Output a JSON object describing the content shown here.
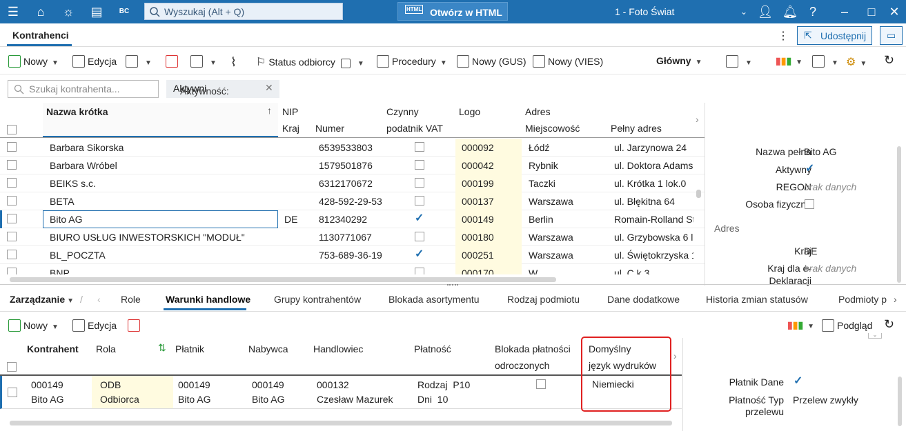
{
  "titlebar": {
    "search_placeholder": "Wyszukaj (Alt + Q)",
    "html_button": "Otwórz w HTML",
    "company": "1 - Foto Świat"
  },
  "tabbar": {
    "active_tab": "Kontrahenci",
    "share": "Udostępnij"
  },
  "toolbar": {
    "new": "Nowy",
    "edit": "Edycja",
    "status": "Status odbiorcy",
    "procedures": "Procedury",
    "new_gus": "Nowy (GUS)",
    "new_vies": "Nowy (VIES)",
    "main": "Główny"
  },
  "filter": {
    "search_placeholder": "Szukaj kontrahenta...",
    "chip_label": "Aktywność:",
    "chip_value": "Aktywni"
  },
  "grid": {
    "headers": {
      "name": "Nazwa krótka",
      "nip": "NIP",
      "country": "Kraj",
      "number": "Numer",
      "vat1": "Czynny",
      "vat2": "podatnik VAT",
      "logo": "Logo",
      "address": "Adres",
      "city": "Miejscowość",
      "full_address": "Pełny adres"
    },
    "rows": [
      {
        "name": "Barbara Sikorska",
        "country": "",
        "nip": "6539533803",
        "vat": false,
        "logo": "000092",
        "city": "Łódź",
        "addr": "ul. Jarzynowa 24"
      },
      {
        "name": "Barbara Wróbel",
        "country": "",
        "nip": "1579501876",
        "vat": false,
        "logo": "000042",
        "city": "Rybnik",
        "addr": "ul. Doktora Adams"
      },
      {
        "name": "BEIKS s.c.",
        "country": "",
        "nip": "6312170672",
        "vat": false,
        "logo": "000199",
        "city": "Taczki",
        "addr": "ul. Krótka 1 lok.0"
      },
      {
        "name": "BETA",
        "country": "",
        "nip": "428-592-29-53",
        "vat": false,
        "logo": "000137",
        "city": "Warszawa",
        "addr": "ul. Błękitna 64"
      },
      {
        "name": "Bito AG",
        "country": "DE",
        "nip": "812340292",
        "vat": true,
        "logo": "000149",
        "city": "Berlin",
        "addr": "Romain-Rolland St"
      },
      {
        "name": "BIURO USŁUG INWESTORSKICH \"MODUŁ\"",
        "country": "",
        "nip": "1130771067",
        "vat": false,
        "logo": "000180",
        "city": "Warszawa",
        "addr": "ul. Grzybowska 6 lo"
      },
      {
        "name": "BL_POCZTA",
        "country": "",
        "nip": "753-689-36-19",
        "vat": true,
        "logo": "000251",
        "city": "Warszawa",
        "addr": "ul. Świętokrzyska 1"
      },
      {
        "name": "BNP",
        "country": "",
        "nip": "",
        "vat": false,
        "logo": "000170",
        "city": "W",
        "addr": "ul. C    k 3"
      }
    ]
  },
  "side": {
    "full_name_label": "Nazwa pełna",
    "full_name": "Bito AG",
    "active_label": "Aktywny",
    "regon_label": "REGON",
    "regon": "brak danych",
    "person_label": "Osoba fizyczna",
    "address_section": "Adres",
    "country_label": "Kraj",
    "country": "DE",
    "edecl_label1": "Kraj dla e-",
    "edecl_label2": "Deklaracji",
    "edecl": "brak danych"
  },
  "tabs2": {
    "manage": "Zarządzanie",
    "items": [
      "Role",
      "Warunki handlowe",
      "Grupy kontrahentów",
      "Blokada asortymentu",
      "Rodzaj podmiotu",
      "Dane dodatkowe",
      "Historia zmian statusów",
      "Podmioty p"
    ]
  },
  "toolbar2": {
    "new": "Nowy",
    "edit": "Edycja",
    "preview": "Podgląd"
  },
  "grid2": {
    "headers": {
      "contractor": "Kontrahent",
      "role": "Rola",
      "payer": "Płatnik",
      "buyer": "Nabywca",
      "salesman": "Handlowiec",
      "payment": "Płatność",
      "block1": "Blokada płatności",
      "block2": "odroczonych",
      "lang1": "Domyślny",
      "lang2": "język wydruków"
    },
    "row": {
      "contractor_code": "000149",
      "contractor_name": "Bito AG",
      "role_code": "ODB",
      "role_name": "Odbiorca",
      "payer_code": "000149",
      "payer_name": "Bito AG",
      "buyer_code": "000149",
      "buyer_name": "Bito AG",
      "salesman_code": "000132",
      "salesman_name": "Czesław Mazurek",
      "payment_line1": "Rodzaj  P10",
      "payment_line2": "Dni  10",
      "language": "Niemiecki"
    }
  },
  "side2": {
    "payer_label": "Płatnik Dane",
    "transfer_label1": "Płatność Typ",
    "transfer_label2": "przelewu",
    "transfer": "Przelew zwykły"
  },
  "colors": {
    "accent": "#1f6fb0",
    "highlight_box": "#e02020",
    "logo_bg": "#fffbe0"
  }
}
